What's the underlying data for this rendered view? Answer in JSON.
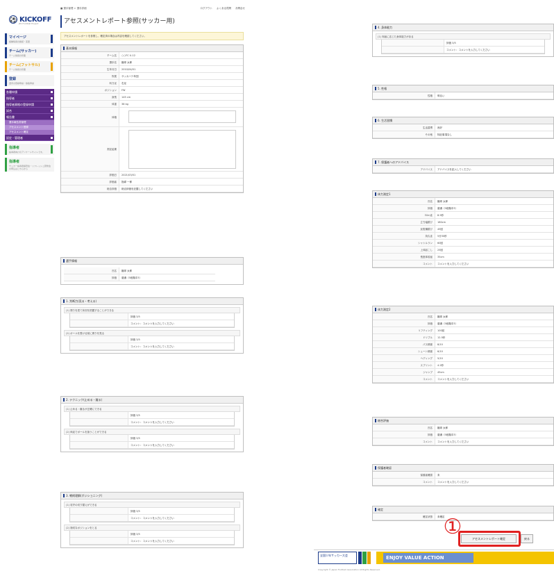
{
  "left": {
    "logo": "KICKOFF",
    "logo_sub": "JFA Football Project",
    "breadcrumb": "■ 選手管理 > 選手詳細",
    "toplinks": [
      "ログアウト",
      "よくある質問",
      "お問合せ"
    ],
    "title": "アセスメントレポート参照(サッカー用)",
    "notice": "アセスメントレポートを参照し、確定済の場合は内容を確認してください。",
    "sidebar": {
      "mypage": {
        "title": "マイページ",
        "sub": "各種情報の確認・変更"
      },
      "team": {
        "title": "チーム(サッカー)",
        "sub": "チーム情報の管理"
      },
      "team_futsal": {
        "title": "チーム(フットサル)",
        "sub": "チーム情報の管理"
      },
      "register": {
        "title": "登録",
        "sub": "選手の登録申請・移籍申請"
      },
      "menu": [
        "各種申請",
        "指導者",
        "指導者資格の登録申請",
        "試合",
        "報告書"
      ],
      "submenu": [
        "選手報告書管理",
        "アセスメント登録",
        "アセスメント確定"
      ],
      "menu2": [
        "設定・管理者"
      ],
      "coach1": {
        "title": "指導者",
        "sub": "指導者向けのアンケートサイトです。"
      },
      "coach2": {
        "title": "指導者",
        "sub": "サッカー指導者講習会・リフレッシュ研修会の申込はこちらから"
      }
    },
    "basic": {
      "header": "基本情報",
      "rows": [
        {
          "k": "チーム名",
          "v": "○○FC U-12"
        },
        {
          "k": "選手名",
          "v": "蹴球 太郎"
        },
        {
          "k": "生年月日",
          "v": "2010/04/01"
        },
        {
          "k": "所属",
          "v": "サッカー少年団"
        },
        {
          "k": "利き足",
          "v": "右足"
        },
        {
          "k": "ポジション",
          "v": "FW"
        },
        {
          "k": "身長",
          "v": "145 cm"
        },
        {
          "k": "体重",
          "v": "38 kg"
        }
      ],
      "extra_rows": [
        {
          "k": "評価日",
          "v": "2021/03/01"
        },
        {
          "k": "評価者",
          "v": "指導 一郎"
        },
        {
          "k": "総合評価",
          "v": "総合評価を記載してください"
        }
      ]
    },
    "player": {
      "header": "選手情報",
      "rows": [
        {
          "k": "氏名",
          "v": "蹴球 太郎"
        },
        {
          "k": "評価",
          "v": "普通（5段階中3）"
        }
      ]
    },
    "section1": {
      "header": "1. 判断力(見る・考える)",
      "q": [
        {
          "title": "(1) 周りを見て状況を把握することができる",
          "score": "評価 3/5",
          "comment": "コメント：コメントを入力してください"
        },
        {
          "title": "(2) ボールを受ける前に周りを見る",
          "score": "評価 3/5",
          "comment": "コメント：コメントを入力してください"
        }
      ]
    },
    "section2": {
      "header": "2. テクニック(止める・蹴る)",
      "q": [
        {
          "title": "(1) 止める・蹴るが正確にできる",
          "score": "評価 3/5",
          "comment": "コメント：コメントを入力してください"
        },
        {
          "title": "(2) 両足でボールを扱うことができる",
          "score": "評価 3/5",
          "comment": "コメント：コメントを入力してください"
        }
      ]
    },
    "section3": {
      "header": "3. 戦術理解(ポジショニング)",
      "q": [
        {
          "title": "(1) 攻守の切り替えができる",
          "score": "評価 3/5",
          "comment": "コメント：コメントを入力してください"
        },
        {
          "title": "(2) 適切なポジションをとる",
          "score": "評価 3/5",
          "comment": "コメント：コメントを入力してください"
        }
      ]
    }
  },
  "right": {
    "sec4": {
      "header": "4. 身体能力",
      "title": "(1) 年齢に応じた身体能力がある",
      "score": "評価 3/5",
      "comment": "コメント：コメントを入力してください"
    },
    "sec5": {
      "header": "5. 性格",
      "rows": [
        {
          "k": "性格",
          "v": "明るい"
        }
      ]
    },
    "sec6": {
      "header": "6. 生活習慣",
      "rows": [
        {
          "k": "生活習慣",
          "v": "良好"
        },
        {
          "k": "その他",
          "v": "特記事項なし"
        }
      ]
    },
    "sec7": {
      "header": "7. 保護者へのアドバイス",
      "rows": [
        {
          "k": "アドバイス",
          "v": "アドバイスを記入してください"
        }
      ]
    },
    "phys1": {
      "header": "体力測定1",
      "rows": [
        {
          "k": "氏名",
          "v": "蹴球 太郎"
        },
        {
          "k": "評価",
          "v": "普通（5段階中3）"
        },
        {
          "k": "50m走",
          "v": "8.5秒"
        },
        {
          "k": "立ち幅跳び",
          "v": "180cm"
        },
        {
          "k": "反復横跳び",
          "v": "45回"
        },
        {
          "k": "持久走",
          "v": "5分30秒"
        },
        {
          "k": "シャトルラン",
          "v": "60回"
        },
        {
          "k": "上体起こし",
          "v": "25回"
        },
        {
          "k": "長座体前屈",
          "v": "35cm"
        },
        {
          "k": "コメント",
          "v": "コメントを入力してください"
        }
      ]
    },
    "phys2": {
      "header": "体力測定2",
      "rows": [
        {
          "k": "氏名",
          "v": "蹴球 太郎"
        },
        {
          "k": "評価",
          "v": "普通（5段階中3）"
        },
        {
          "k": "リフティング",
          "v": "100回"
        },
        {
          "k": "ドリブル",
          "v": "12.5秒"
        },
        {
          "k": "パス精度",
          "v": "8/10"
        },
        {
          "k": "シュート精度",
          "v": "6/10"
        },
        {
          "k": "ヘディング",
          "v": "5/10"
        },
        {
          "k": "スプリント",
          "v": "4.2秒"
        },
        {
          "k": "ジャンプ",
          "v": "45cm"
        },
        {
          "k": "コメント",
          "v": "コメントを入力してください"
        }
      ]
    },
    "overall": {
      "header": "総合評価",
      "rows": [
        {
          "k": "氏名",
          "v": "蹴球 太郎"
        },
        {
          "k": "評価",
          "v": "普通（5段階中3）"
        },
        {
          "k": "コメント",
          "v": "コメントを入力してください"
        }
      ]
    },
    "guardian": {
      "header": "保護者確認",
      "rows": [
        {
          "k": "保護者確認",
          "v": "未"
        },
        {
          "k": "コメント",
          "v": "コメントを入力してください"
        }
      ]
    },
    "confirm": {
      "header": "確定",
      "rows": [
        {
          "k": "確定状態",
          "v": "未確定"
        }
      ]
    },
    "marker": "①",
    "btn_confirm": "アセスメントレポート確定",
    "btn_back": "戻る",
    "footer": {
      "banner1": "全国少年サッカー大会",
      "banner2": "ENJOY VALUE ACTION",
      "fine": "Copyright © Japan Football Association All Rights Reserved."
    }
  }
}
